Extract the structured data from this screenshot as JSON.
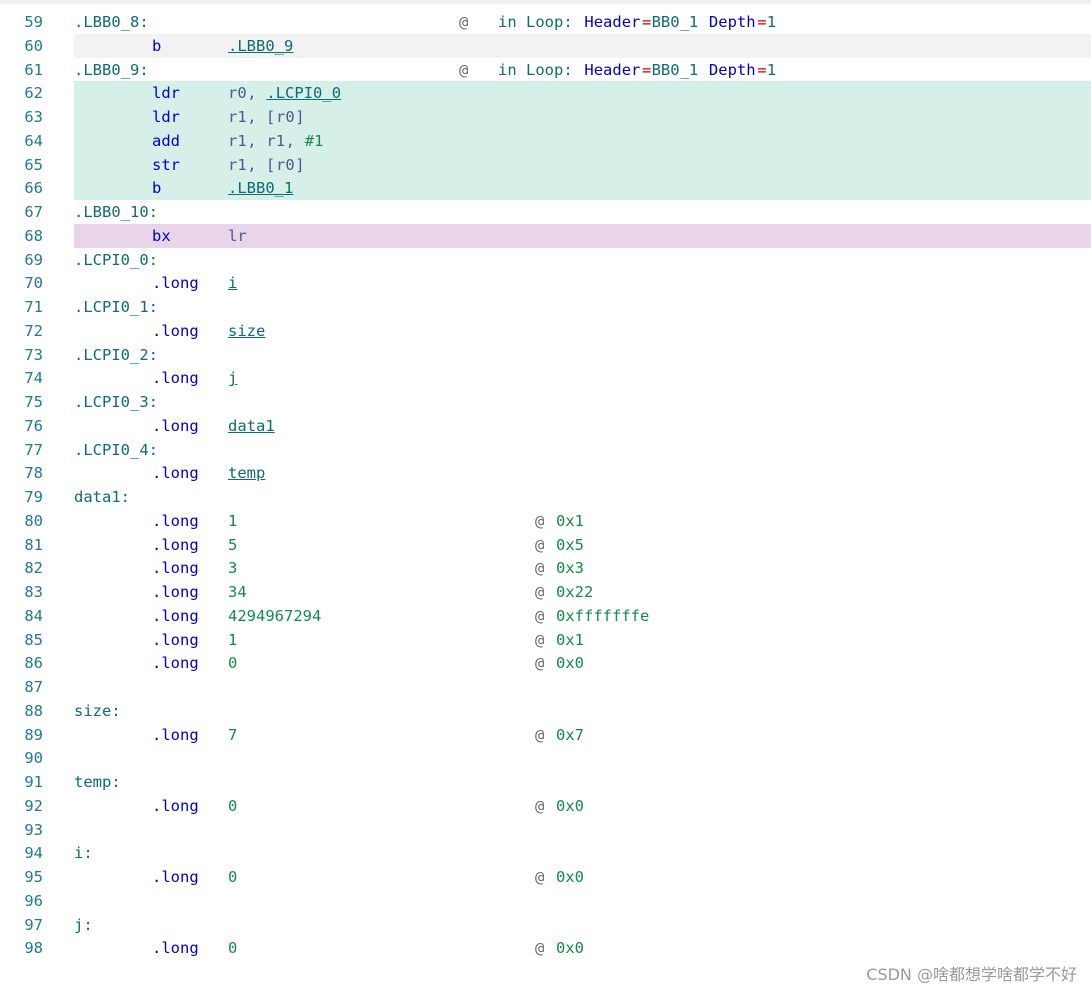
{
  "lines": [
    {
      "n": "59",
      "label": ".LBB0_8:",
      "cA": "@",
      "cB": [
        "in Loop: ",
        "Header",
        "=",
        "BB0_1",
        " Depth",
        "=",
        "1"
      ]
    },
    {
      "n": "60",
      "op": "b",
      "args": [
        {
          "t": ".LBB0_9",
          "c": "ref"
        }
      ],
      "hl": "gray"
    },
    {
      "n": "61",
      "label": ".LBB0_9:",
      "cA": "@",
      "cB": [
        "in Loop: ",
        "Header",
        "=",
        "BB0_1",
        " Depth",
        "=",
        "1"
      ]
    },
    {
      "n": "62",
      "op": "ldr",
      "args": [
        {
          "t": "r0",
          "c": "reg"
        },
        {
          "t": ", ",
          "c": "reg"
        },
        {
          "t": ".LCPI0_0",
          "c": "ref"
        }
      ],
      "hl": "green"
    },
    {
      "n": "63",
      "op": "ldr",
      "args": [
        {
          "t": "r1",
          "c": "reg"
        },
        {
          "t": ", [",
          "c": "reg"
        },
        {
          "t": "r0",
          "c": "reg"
        },
        {
          "t": "]",
          "c": "reg"
        }
      ],
      "hl": "green"
    },
    {
      "n": "64",
      "op": "add",
      "args": [
        {
          "t": "r1",
          "c": "reg"
        },
        {
          "t": ", ",
          "c": "reg"
        },
        {
          "t": "r1",
          "c": "reg"
        },
        {
          "t": ", ",
          "c": "reg"
        },
        {
          "t": "#1",
          "c": "num"
        }
      ],
      "hl": "green"
    },
    {
      "n": "65",
      "op": "str",
      "args": [
        {
          "t": "r1",
          "c": "reg"
        },
        {
          "t": ", [",
          "c": "reg"
        },
        {
          "t": "r0",
          "c": "reg"
        },
        {
          "t": "]",
          "c": "reg"
        }
      ],
      "hl": "green"
    },
    {
      "n": "66",
      "op": "b",
      "args": [
        {
          "t": ".LBB0_1",
          "c": "ref"
        }
      ],
      "hl": "green"
    },
    {
      "n": "67",
      "label": ".LBB0_10:"
    },
    {
      "n": "68",
      "op": "bx",
      "args": [
        {
          "t": "lr",
          "c": "reg"
        }
      ],
      "hl": "purple"
    },
    {
      "n": "69",
      "label": ".LCPI0_0:"
    },
    {
      "n": "70",
      "op": ".long",
      "args": [
        {
          "t": "i",
          "c": "ref"
        }
      ]
    },
    {
      "n": "71",
      "label": ".LCPI0_1:"
    },
    {
      "n": "72",
      "op": ".long",
      "args": [
        {
          "t": "size",
          "c": "ref"
        }
      ]
    },
    {
      "n": "73",
      "label": ".LCPI0_2:"
    },
    {
      "n": "74",
      "op": ".long",
      "args": [
        {
          "t": "j",
          "c": "ref"
        }
      ]
    },
    {
      "n": "75",
      "label": ".LCPI0_3:"
    },
    {
      "n": "76",
      "op": ".long",
      "args": [
        {
          "t": "data1",
          "c": "ref"
        }
      ]
    },
    {
      "n": "77",
      "label": ".LCPI0_4:"
    },
    {
      "n": "78",
      "op": ".long",
      "args": [
        {
          "t": "temp",
          "c": "ref"
        }
      ]
    },
    {
      "n": "79",
      "label": "data1:"
    },
    {
      "n": "80",
      "op": ".long",
      "args": [
        {
          "t": "1",
          "c": "num"
        }
      ],
      "hex": "0x1"
    },
    {
      "n": "81",
      "op": ".long",
      "args": [
        {
          "t": "5",
          "c": "num"
        }
      ],
      "hex": "0x5"
    },
    {
      "n": "82",
      "op": ".long",
      "args": [
        {
          "t": "3",
          "c": "num"
        }
      ],
      "hex": "0x3"
    },
    {
      "n": "83",
      "op": ".long",
      "args": [
        {
          "t": "34",
          "c": "num"
        }
      ],
      "hex": "0x22"
    },
    {
      "n": "84",
      "op": ".long",
      "args": [
        {
          "t": "4294967294",
          "c": "num"
        }
      ],
      "hex": "0xfffffffe"
    },
    {
      "n": "85",
      "op": ".long",
      "args": [
        {
          "t": "1",
          "c": "num"
        }
      ],
      "hex": "0x1"
    },
    {
      "n": "86",
      "op": ".long",
      "args": [
        {
          "t": "0",
          "c": "num"
        }
      ],
      "hex": "0x0"
    },
    {
      "n": "87"
    },
    {
      "n": "88",
      "label": "size:"
    },
    {
      "n": "89",
      "op": ".long",
      "args": [
        {
          "t": "7",
          "c": "num"
        }
      ],
      "hex": "0x7"
    },
    {
      "n": "90"
    },
    {
      "n": "91",
      "label": "temp:"
    },
    {
      "n": "92",
      "op": ".long",
      "args": [
        {
          "t": "0",
          "c": "num"
        }
      ],
      "hex": "0x0"
    },
    {
      "n": "93"
    },
    {
      "n": "94",
      "label": "i:"
    },
    {
      "n": "95",
      "op": ".long",
      "args": [
        {
          "t": "0",
          "c": "num"
        }
      ],
      "hex": "0x0"
    },
    {
      "n": "96"
    },
    {
      "n": "97",
      "label": "j:"
    },
    {
      "n": "98",
      "op": ".long",
      "args": [
        {
          "t": "0",
          "c": "num"
        }
      ],
      "hex": "0x0"
    }
  ],
  "watermark": "CSDN @啥都想学啥都学不好"
}
